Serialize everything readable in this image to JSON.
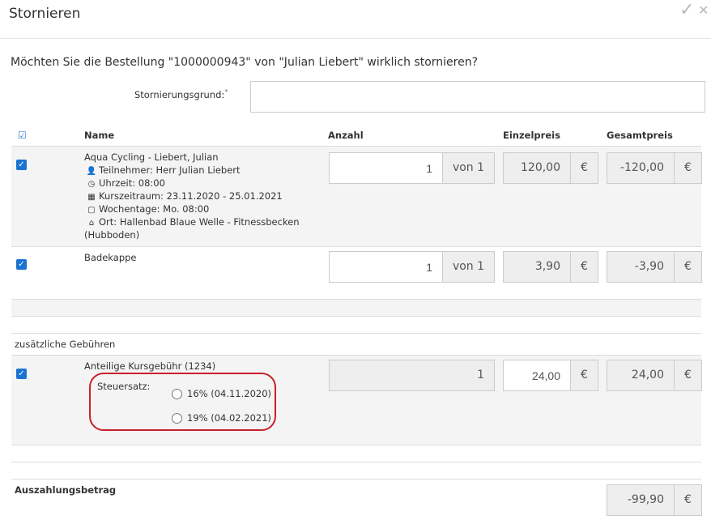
{
  "dialog": {
    "title": "Stornieren",
    "question": "Möchten Sie die Bestellung \"1000000943\" von \"Julian Liebert\" wirklich stornieren?",
    "reason_label": "Stornierungsgrund:",
    "reason_required_mark": "*",
    "reason_value": ""
  },
  "table": {
    "headers": {
      "name": "Name",
      "quantity": "Anzahl",
      "unit_price": "Einzelpreis",
      "total_price": "Gesamtpreis"
    },
    "items": [
      {
        "checked": true,
        "name": "Aqua Cycling - Liebert, Julian",
        "details": [
          {
            "icon": "user-icon",
            "text": "Teilnehmer: Herr Julian Liebert"
          },
          {
            "icon": "clock-icon",
            "text": "Uhrzeit: 08:00"
          },
          {
            "icon": "calendar-range-icon",
            "text": "Kurszeitraum: 23.11.2020 - 25.01.2021"
          },
          {
            "icon": "calendar-icon",
            "text": "Wochentage: Mo. 08:00"
          },
          {
            "icon": "home-icon",
            "text": "Ort: Hallenbad Blaue Welle - Fitnessbecken"
          }
        ],
        "details_continuation": "(Hubboden)",
        "quantity": "1",
        "quantity_of": "von 1",
        "unit_price": "120,00",
        "total_price": "-120,00",
        "currency": "€"
      },
      {
        "checked": true,
        "name": "Badekappe",
        "quantity": "1",
        "quantity_of": "von 1",
        "unit_price": "3,90",
        "total_price": "-3,90",
        "currency": "€"
      }
    ],
    "fees_section_label": "zusätzliche Gebühren",
    "fees": [
      {
        "checked": true,
        "name": "Anteilige Kursgebühr (1234)",
        "tax_label": "Steuersatz:",
        "tax_options": [
          {
            "label": "16% (04.11.2020)",
            "selected": false
          },
          {
            "label": "19% (04.02.2021)",
            "selected": false
          }
        ],
        "quantity": "1",
        "unit_price": "24,00",
        "total_price": "24,00",
        "currency": "€"
      }
    ],
    "payout": {
      "label": "Auszahlungsbetrag",
      "value": "-99,90",
      "currency": "€"
    }
  },
  "colors": {
    "checkbox": "#1a73d1",
    "highlight": "#c8202a"
  }
}
